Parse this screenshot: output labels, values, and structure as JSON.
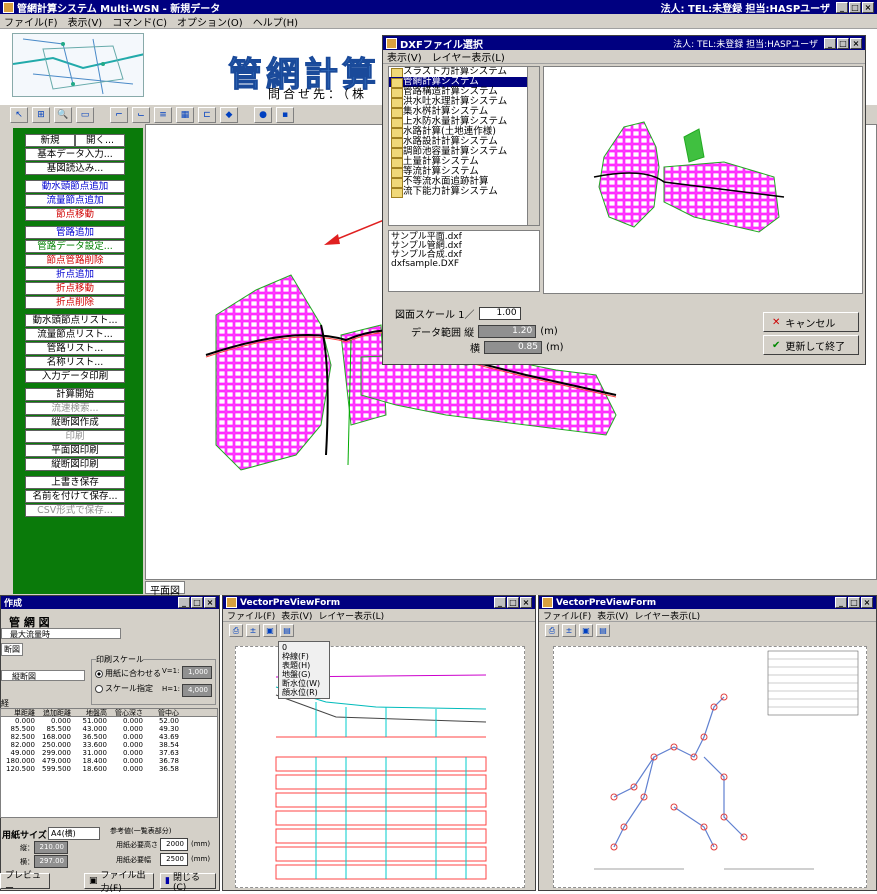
{
  "app": {
    "title": "管網計算システム Multi-WSN - 新規データ",
    "title_right": "法人:  TEL:未登録  担当:HASPユーザ",
    "menu": [
      "ファイル(F)",
      "表示(V)",
      "コマンド(C)",
      "オプション(O)",
      "ヘルプ(H)"
    ],
    "banner_title": "管網計算",
    "contact": "問合せ先：（株",
    "sidebar": {
      "new": "新規",
      "open": "開く...",
      "items_a": [
        "基本データ入力...",
        "基図読込み..."
      ],
      "items_b": [
        "動水頭節点追加",
        "流量節点追加",
        "節点移動"
      ],
      "items_c": [
        "管路追加",
        "管路データ設定...",
        "節点管路削除",
        "折点追加",
        "折点移動",
        "折点削除"
      ],
      "items_d": [
        "動水頭節点リスト...",
        "流量節点リスト...",
        "管路リスト...",
        "名称リスト...",
        "入力データ印刷"
      ],
      "items_e": [
        "計算開始",
        "流速検索...",
        "縦断図作成",
        "印刷",
        "平面図印刷",
        "縦断図印刷"
      ],
      "items_f": [
        "上書き保存",
        "名前を付けて保存...",
        "CSV形式で保存..."
      ]
    },
    "canvas_tab": "平面図"
  },
  "dialog": {
    "title": "DXFファイル選択",
    "title_right": "法人:  TEL:未登録  担当:HASPユーザ",
    "menu": [
      "表示(V)",
      "レイヤー表示(L)"
    ],
    "folders": [
      "スラスト力計算システム",
      "管網計算システム",
      "管路構造計算システム",
      "洪水吐水理計算システム",
      "集水桝計算システム",
      "上水防水量計算システム",
      "水路計算(土地連作様)",
      "水路設計計算システム",
      "調節池容量計算システム",
      "土量計算システム",
      "等流計算システム",
      "不等流水面追跡計算",
      "流下能力計算システム"
    ],
    "selected_folder": "管網計算システム",
    "files": [
      "サンプル平面.dxf",
      "サンプル管網.dxf",
      "サンプル合成.dxf",
      "dxfsample.DXF"
    ],
    "scale_label": "図面スケール  1／",
    "scale_value": "1.00",
    "range_label": "データ範囲  縦",
    "range_v": "1.20",
    "range_h_label": "横",
    "range_h": "0.85",
    "unit": "(m)",
    "cancel": "キャンセル",
    "ok": "更新して終了"
  },
  "left_win": {
    "title": "作成",
    "heading": "管 網 図",
    "select": "最大流量時",
    "tab": "断図",
    "combo": "縦断図",
    "print_scale": "印刷スケール",
    "radio_fit": "用紙に合わせる",
    "radio_scale": "スケール指定",
    "v_label": "V=1:",
    "v_value": "1,000",
    "h_label": "H=1:",
    "h_value": "4,000",
    "section": "経",
    "headers": [
      "単距離",
      "追加距離",
      "地盤高",
      "管心深さ",
      "管中心"
    ],
    "rows": [
      [
        "0.000",
        "0.000",
        "51.000",
        "0.000",
        "52.00"
      ],
      [
        "85.500",
        "85.500",
        "43.000",
        "0.000",
        "49.30"
      ],
      [
        "82.500",
        "168.000",
        "36.500",
        "0.000",
        "43.69"
      ],
      [
        "82.000",
        "250.000",
        "33.600",
        "0.000",
        "38.54"
      ],
      [
        "49.000",
        "299.000",
        "31.000",
        "0.000",
        "37.63"
      ],
      [
        "180.000",
        "479.000",
        "18.400",
        "0.000",
        "36.78"
      ],
      [
        "120.500",
        "599.500",
        "18.600",
        "0.000",
        "36.58"
      ]
    ],
    "paper_label": "用紙サイズ",
    "paper_value": "A4(横)",
    "w_label": "縦：",
    "w_value": "210.00",
    "h2_label": "横：",
    "h2_value": "297.00",
    "ref_label": "参考値(一覧表部分)",
    "ref_a_label": "用紙必要高さ",
    "ref_a": "2000",
    "ref_b_label": "用紙必要幅",
    "ref_b": "2500",
    "mm": "(mm)",
    "preview_btn": "プレビュー",
    "file_out": "ファイル出力(F)",
    "close": "閉じる(C)"
  },
  "mid_win": {
    "title": "VectorPreViewForm",
    "menu": [
      "ファイル(F)",
      "表示(V)",
      "レイヤー表示(L)"
    ],
    "dropdown": [
      "0",
      "枠線(F)",
      "表題(H)",
      "地盤(G)",
      "断水位(W)",
      "顔水位(R)"
    ]
  },
  "right_win": {
    "title": "VectorPreViewForm",
    "menu": [
      "ファイル(F)",
      "表示(V)",
      "レイヤー表示(L)"
    ]
  }
}
